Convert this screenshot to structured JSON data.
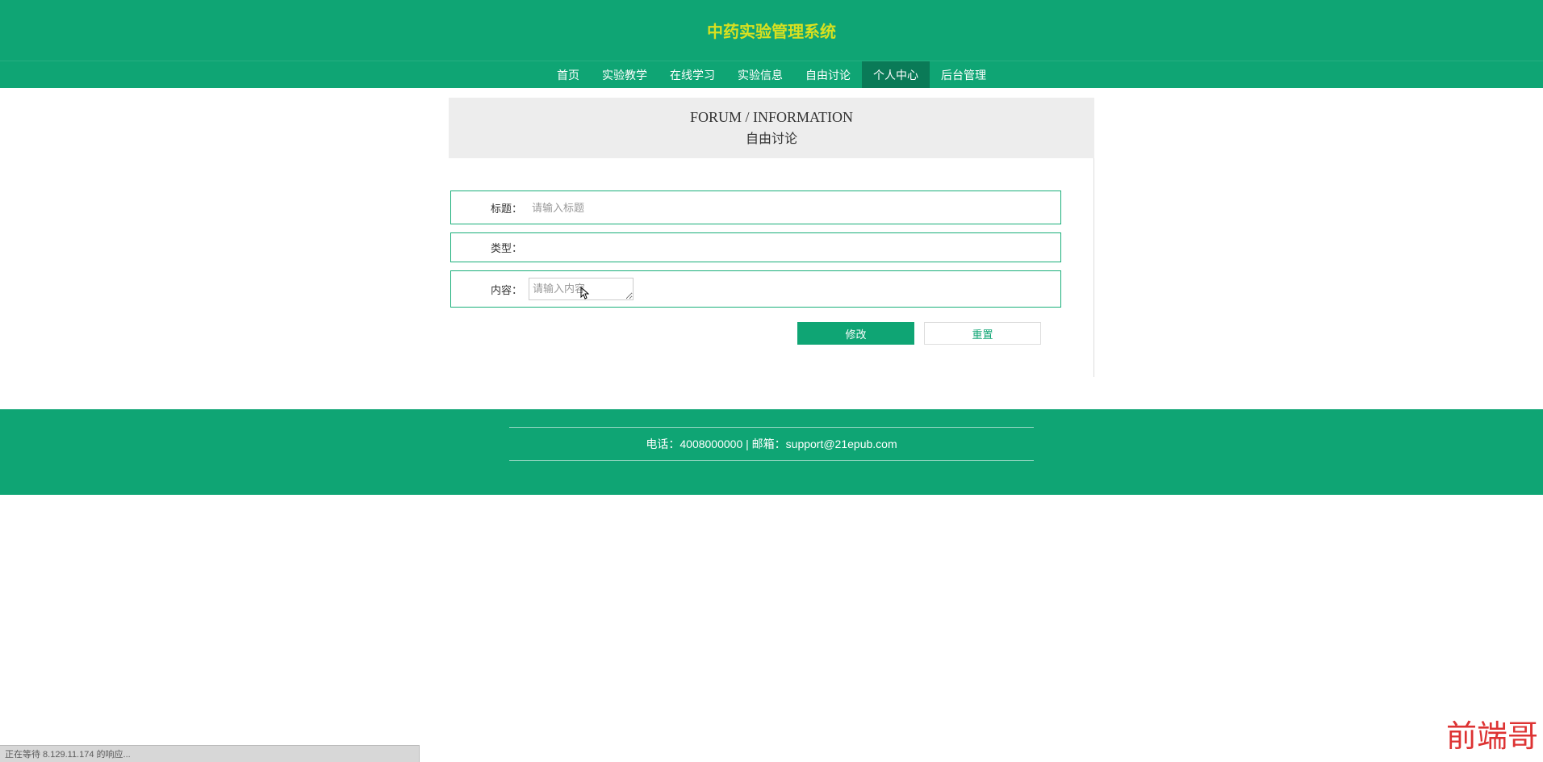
{
  "header": {
    "title": "中药实验管理系统"
  },
  "nav": {
    "items": [
      {
        "label": "首页",
        "active": false
      },
      {
        "label": "实验教学",
        "active": false
      },
      {
        "label": "在线学习",
        "active": false
      },
      {
        "label": "实验信息",
        "active": false
      },
      {
        "label": "自由讨论",
        "active": false
      },
      {
        "label": "个人中心",
        "active": true
      },
      {
        "label": "后台管理",
        "active": false
      }
    ]
  },
  "section": {
    "title_en": "FORUM / INFORMATION",
    "title_zh": "自由讨论"
  },
  "form": {
    "title_label": "标题：",
    "title_placeholder": "请输入标题",
    "type_label": "类型：",
    "content_label": "内容：",
    "content_placeholder": "请输入内容",
    "submit_label": "修改",
    "reset_label": "重置"
  },
  "footer": {
    "contact": "电话：4008000000 | 邮箱：support@21epub.com"
  },
  "status_bar": "正在等待 8.129.11.174 的响应...",
  "watermark": "前端哥"
}
